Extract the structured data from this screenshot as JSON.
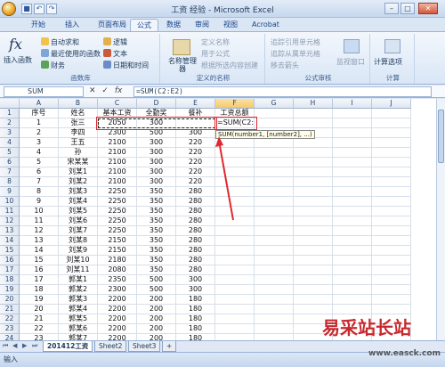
{
  "window": {
    "title": "工资 经验 - Microsoft Excel"
  },
  "tabs": [
    "开始",
    "插入",
    "页面布局",
    "公式",
    "数据",
    "审阅",
    "视图",
    "Acrobat"
  ],
  "active_tab": "公式",
  "ribbon": {
    "fx_label": "插入函数",
    "group1": {
      "autosum": "自动求和",
      "recent": "最近使用的函数",
      "finance": "财务",
      "logic": "逻辑",
      "text": "文本",
      "datetime": "日期和时间",
      "label": "函数库"
    },
    "group2": {
      "name_mgr": "名称管理器",
      "define": "定义名称",
      "use": "用于公式",
      "create": "根据所选内容创建",
      "label": "定义的名称"
    },
    "group3": {
      "trace_prec": "追踪引用单元格",
      "trace_dep": "追踪从属单元格",
      "remove": "移去箭头",
      "watch": "监视窗口",
      "label": "公式审核"
    },
    "group4": {
      "calc_opt": "计算选项",
      "label": "计算"
    }
  },
  "formula_bar": {
    "name_box": "SUM",
    "formula": "=SUM(C2:E2)"
  },
  "columns": [
    "A",
    "B",
    "C",
    "D",
    "E",
    "F",
    "G",
    "H",
    "I",
    "J"
  ],
  "headers": [
    "序号",
    "姓名",
    "基本工资",
    "全勤奖",
    "餐补",
    "工资总额"
  ],
  "rows": [
    [
      "1",
      "张三",
      "2050",
      "300",
      "",
      "=SUM(C2:E2)"
    ],
    [
      "2",
      "李四",
      "2300",
      "500",
      "300",
      ""
    ],
    [
      "3",
      "王五",
      "2100",
      "300",
      "220",
      ""
    ],
    [
      "4",
      "孙",
      "2100",
      "300",
      "220",
      ""
    ],
    [
      "5",
      "宋某某",
      "2100",
      "300",
      "220",
      ""
    ],
    [
      "6",
      "刘某1",
      "2100",
      "300",
      "220",
      ""
    ],
    [
      "7",
      "刘某2",
      "2100",
      "300",
      "220",
      ""
    ],
    [
      "8",
      "刘某3",
      "2250",
      "350",
      "280",
      ""
    ],
    [
      "9",
      "刘某4",
      "2250",
      "350",
      "280",
      ""
    ],
    [
      "10",
      "刘某5",
      "2250",
      "350",
      "280",
      ""
    ],
    [
      "11",
      "刘某6",
      "2250",
      "350",
      "280",
      ""
    ],
    [
      "12",
      "刘某7",
      "2250",
      "350",
      "280",
      ""
    ],
    [
      "13",
      "刘某8",
      "2150",
      "350",
      "280",
      ""
    ],
    [
      "14",
      "刘某9",
      "2150",
      "350",
      "280",
      ""
    ],
    [
      "15",
      "刘某10",
      "2180",
      "350",
      "280",
      ""
    ],
    [
      "16",
      "刘某11",
      "2080",
      "350",
      "280",
      ""
    ],
    [
      "17",
      "郭某1",
      "2350",
      "500",
      "300",
      ""
    ],
    [
      "18",
      "郭某2",
      "2300",
      "500",
      "300",
      ""
    ],
    [
      "19",
      "郭某3",
      "2200",
      "200",
      "180",
      ""
    ],
    [
      "20",
      "郭某4",
      "2200",
      "200",
      "180",
      ""
    ],
    [
      "21",
      "郭某5",
      "2200",
      "200",
      "180",
      ""
    ],
    [
      "22",
      "郭某6",
      "2200",
      "200",
      "180",
      ""
    ],
    [
      "23",
      "郭某7",
      "2200",
      "200",
      "180",
      ""
    ]
  ],
  "tooltip": "SUM(number1, [number2], ...)",
  "sheets": [
    "201412工资",
    "Sheet2",
    "Sheet3"
  ],
  "status": "输入",
  "watermark": {
    "cn": "易采站长站",
    "url": "www.easck.com"
  }
}
